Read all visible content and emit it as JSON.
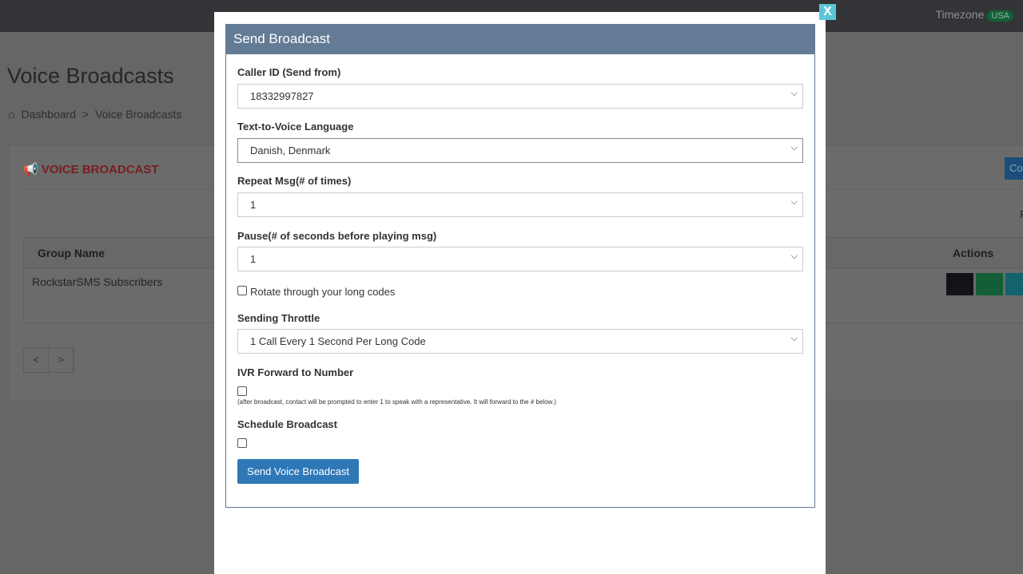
{
  "topbar": {
    "timezone_label": "Timezone",
    "timezone_badge": "USA"
  },
  "page": {
    "title": "Voice Broadcasts",
    "breadcrumb": [
      "Dashboard",
      ">",
      "Voice Broadcasts"
    ]
  },
  "card": {
    "title": "VOICE BROADCAST",
    "create_button": "Co",
    "filter_partial": "F",
    "table": {
      "headers": {
        "group_name": "Group Name",
        "actions": "Actions"
      },
      "rows": [
        {
          "group_name": "RockstarSMS Subscribers"
        }
      ]
    },
    "pagination": {
      "prev": "<",
      "next": ">"
    }
  },
  "modal": {
    "close": "X",
    "title": "Send Broadcast",
    "fields": {
      "caller_id": {
        "label": "Caller ID (Send from)",
        "value": "18332997827"
      },
      "language": {
        "label": "Text-to-Voice Language",
        "value": "Danish, Denmark"
      },
      "repeat": {
        "label": "Repeat Msg(# of times)",
        "value": "1"
      },
      "pause": {
        "label": "Pause(# of seconds before playing msg)",
        "value": "1"
      },
      "rotate": {
        "label": "Rotate through your long codes",
        "checked": false
      },
      "throttle": {
        "label": "Sending Throttle",
        "value": "1 Call Every 1 Second Per Long Code"
      },
      "ivr": {
        "label": "IVR Forward to Number",
        "help": "(after broadcast, contact will be prompted to enter 1 to speak with a representative. It will forward to the # below.)",
        "checked": false
      },
      "schedule": {
        "label": "Schedule Broadcast",
        "checked": false
      }
    },
    "submit": "Send Voice Broadcast"
  },
  "colors": {
    "modal_header": "#637b94",
    "submit": "#2f78b7",
    "close": "#5bc6d8",
    "card_title": "#c0282e"
  }
}
